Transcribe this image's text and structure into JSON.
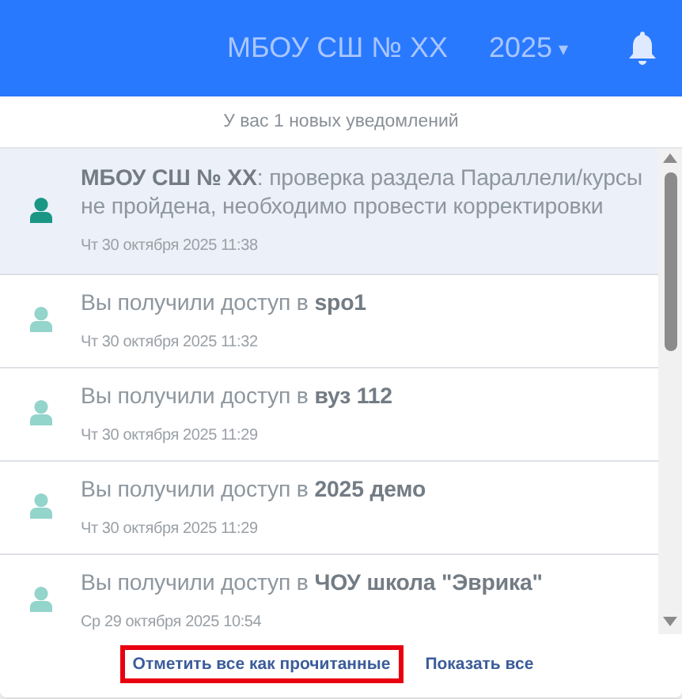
{
  "header": {
    "school": "МБОУ СШ № ХХ",
    "year": "2025",
    "year_caret": "▾"
  },
  "notifications": {
    "summary": "У вас 1 новых уведомлений",
    "items": [
      {
        "message": "**МБОУ СШ № ХХ**: проверка раздела Параллели/курсы не пройдена, необходимо провести корректировки",
        "time": "Чт 30 октября 2025 11:38",
        "unread": true
      },
      {
        "message": "Вы получили доступ в **spo1**",
        "time": "Чт 30 октября 2025 11:32",
        "unread": false
      },
      {
        "message": "Вы получили доступ в **вуз 112**",
        "time": "Чт 30 октября 2025 11:29",
        "unread": false
      },
      {
        "message": "Вы получили доступ в **2025 демо**",
        "time": "Чт 30 октября 2025 11:29",
        "unread": false
      },
      {
        "message": "Вы получили доступ в **ЧОУ школа \"Эврика\"**",
        "time": "Ср 29 октября 2025 10:54",
        "unread": false
      }
    ],
    "actions": [
      {
        "label": "Отметить все как прочитанные",
        "highlighted": true
      },
      {
        "label": "Показать все",
        "highlighted": false
      }
    ]
  }
}
